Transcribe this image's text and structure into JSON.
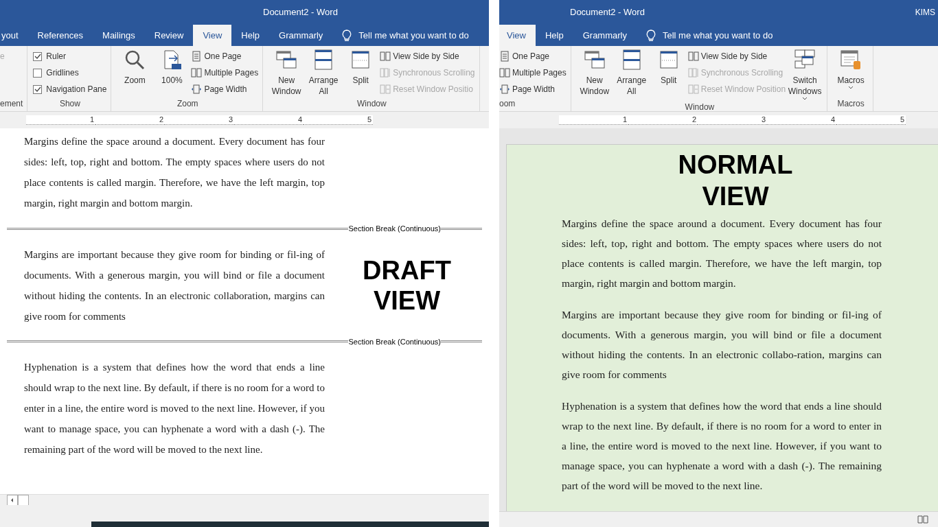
{
  "panes": [
    {
      "kind": "draft",
      "title": "Document2  -  Word",
      "tabs": [
        {
          "label": "yout",
          "selected": false
        },
        {
          "label": "References",
          "selected": false
        },
        {
          "label": "Mailings",
          "selected": false
        },
        {
          "label": "Review",
          "selected": false
        },
        {
          "label": "View",
          "selected": true
        },
        {
          "label": "Help",
          "selected": false
        },
        {
          "label": "Grammarly",
          "selected": false
        }
      ],
      "tell_me": "Tell me what you want to do",
      "groups": [
        {
          "label": "ement",
          "columns": [
            {
              "kind": "stack",
              "items": [
                {
                  "kind": "blank",
                  "label": "e",
                  "disabled": true
                }
              ]
            }
          ]
        },
        {
          "label": "Show",
          "columns": [
            {
              "kind": "stack",
              "items": [
                {
                  "kind": "checkbox",
                  "label": "Ruler",
                  "checked": true
                },
                {
                  "kind": "checkbox",
                  "label": "Gridlines",
                  "checked": false
                },
                {
                  "kind": "checkbox",
                  "label": "Navigation Pane",
                  "checked": true
                }
              ]
            }
          ]
        },
        {
          "label": "Zoom",
          "columns": [
            {
              "kind": "large",
              "item": {
                "kind": "zoom",
                "label": "Zoom"
              }
            },
            {
              "kind": "large",
              "item": {
                "kind": "hundred",
                "label": "100%"
              }
            },
            {
              "kind": "stack",
              "items": [
                {
                  "kind": "one-page",
                  "label": "One Page",
                  "disabled": false
                },
                {
                  "kind": "multiple-pages",
                  "label": "Multiple Pages",
                  "disabled": false
                },
                {
                  "kind": "page-width",
                  "label": "Page Width",
                  "disabled": false
                }
              ]
            }
          ]
        },
        {
          "label": "Window",
          "columns": [
            {
              "kind": "large",
              "item": {
                "kind": "new-window",
                "label": "New Window"
              }
            },
            {
              "kind": "large",
              "item": {
                "kind": "arrange",
                "label": "Arrange All"
              }
            },
            {
              "kind": "large",
              "item": {
                "kind": "split",
                "label": "Split"
              }
            },
            {
              "kind": "stack",
              "items": [
                {
                  "kind": "side-by-side",
                  "label": "View Side by Side",
                  "disabled": false
                },
                {
                  "kind": "sync",
                  "label": "Synchronous Scrolling",
                  "disabled": true
                },
                {
                  "kind": "reset",
                  "label": "Reset Window Positio",
                  "disabled": true
                }
              ]
            }
          ]
        }
      ],
      "ruler": [
        "1",
        "2",
        "3",
        "4",
        "5"
      ],
      "overlay": "DRAFT VIEW",
      "blocks": [
        {
          "kind": "paragraph",
          "text": "Margins define the space around a document. Every document has four sides: left, top, right and bottom. The empty spaces where users do not place contents is called margin. Therefore, we have the left margin, top margin, right margin and bottom margin."
        },
        {
          "kind": "break",
          "text": "Section Break (Continuous)"
        },
        {
          "kind": "paragraph",
          "text": "Margins are important because they give room for binding or fil-ing of documents. With a generous margin, you will bind or file a document without hiding the contents. In an electronic collaboration, margins can give room for comments"
        },
        {
          "kind": "break",
          "text": "Section Break (Continuous)"
        },
        {
          "kind": "paragraph",
          "text": "Hyphenation is a system that defines how the word that ends a line should wrap to the next line. By default, if there is no room for a word to enter in a line, the entire word is moved to the next line. However, if you want to manage space, you can hyphenate a word with a dash (-). The remaining part of the word will be moved to the next line."
        }
      ]
    },
    {
      "kind": "normal",
      "title": "Document2  -  Word",
      "account": "KIMS",
      "tabs": [
        {
          "label": "View",
          "selected": true
        },
        {
          "label": "Help",
          "selected": false
        },
        {
          "label": "Grammarly",
          "selected": false
        }
      ],
      "tell_me": "Tell me what you want to do",
      "groups": [
        {
          "label": "oom",
          "columns": [
            {
              "kind": "stack",
              "items": [
                {
                  "kind": "one-page",
                  "label": "One Page",
                  "disabled": false
                },
                {
                  "kind": "multiple-pages",
                  "label": "Multiple Pages",
                  "disabled": false
                },
                {
                  "kind": "page-width",
                  "label": "Page Width",
                  "disabled": false
                }
              ]
            }
          ]
        },
        {
          "label": "Window",
          "columns": [
            {
              "kind": "large",
              "item": {
                "kind": "new-window",
                "label": "New Window"
              }
            },
            {
              "kind": "large",
              "item": {
                "kind": "arrange",
                "label": "Arrange All"
              }
            },
            {
              "kind": "large",
              "item": {
                "kind": "split",
                "label": "Split"
              }
            },
            {
              "kind": "stack",
              "items": [
                {
                  "kind": "side-by-side",
                  "label": "View Side by Side",
                  "disabled": false
                },
                {
                  "kind": "sync",
                  "label": "Synchronous Scrolling",
                  "disabled": true
                },
                {
                  "kind": "reset",
                  "label": "Reset Window Position",
                  "disabled": true
                }
              ]
            },
            {
              "kind": "large",
              "item": {
                "kind": "switch",
                "label": "Switch Windows",
                "dropdown": true
              }
            }
          ]
        },
        {
          "label": "Macros",
          "columns": [
            {
              "kind": "large",
              "item": {
                "kind": "macros",
                "label": "Macros",
                "dropdown": true
              }
            }
          ]
        }
      ],
      "ruler": [
        "1",
        "2",
        "3",
        "4",
        "5"
      ],
      "overlay": "NORMAL VIEW",
      "blocks": [
        {
          "kind": "paragraph",
          "text": "Margins define the space around a document. Every document has four sides: left, top, right and bottom. The empty spaces where users do not place contents is called margin. Therefore, we have the left margin, top margin, right margin and bottom margin."
        },
        {
          "kind": "paragraph",
          "text": "Margins are important because they give room for binding or fil-ing of documents. With a generous margin, you will bind or file a document without hiding the contents. In an electronic collabo-ration, margins can give room for comments"
        },
        {
          "kind": "paragraph",
          "text": "Hyphenation is a system that defines how the word that ends a line should wrap to the next line. By default, if there is no room for a word to enter in a line, the entire word is moved to the next line. However, if you want to manage space, you can hyphenate a word with a dash (-). The remaining part of the word will be moved to the next line."
        }
      ]
    }
  ]
}
